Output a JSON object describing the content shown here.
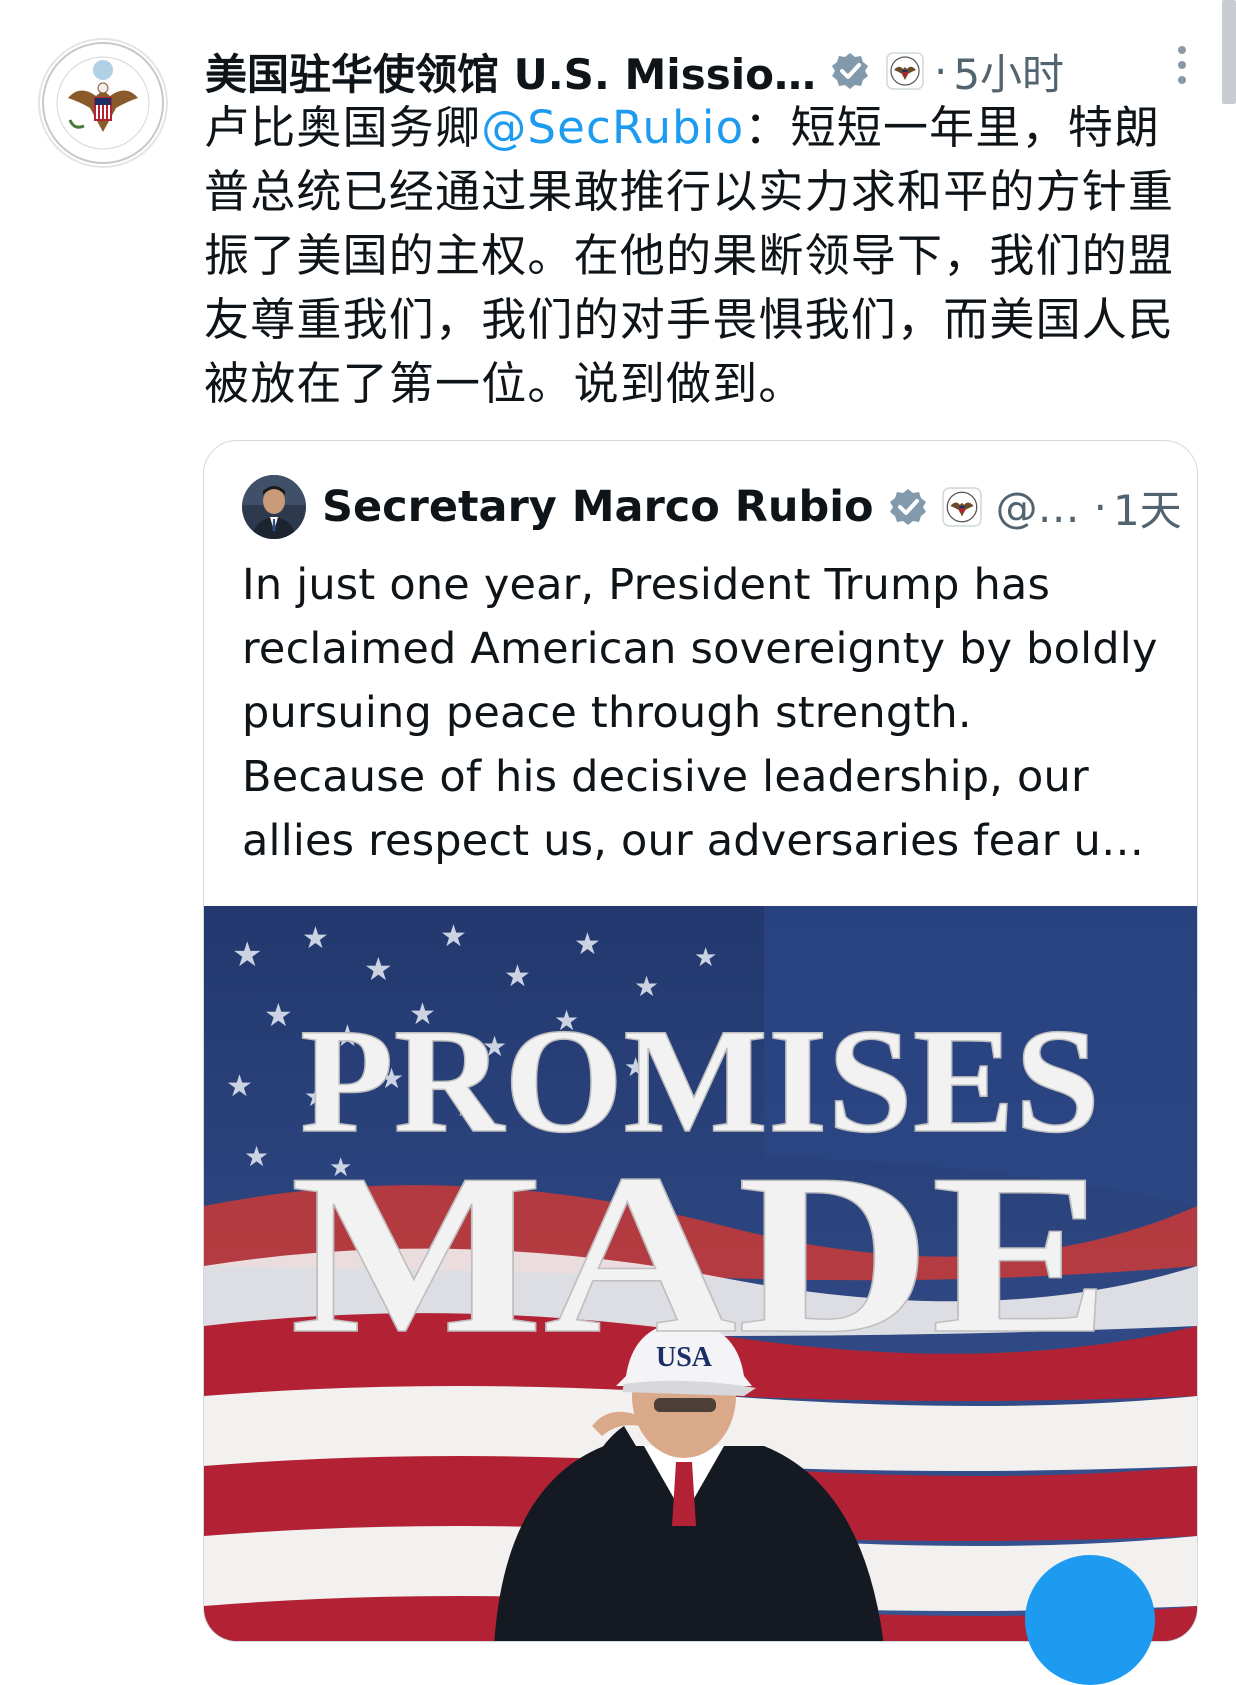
{
  "post": {
    "display_name": "美国驻华使领馆 U.S. Missio…",
    "separator": "·",
    "time": "5小时",
    "text_prefix": "卢比奥国务卿",
    "mention": "@SecRubio",
    "text_rest": "：短短一年里，特朗普总统已经通过果敢推行以实力求和平的方针重振了美国的主权。在他的果断领导下，我们的盟友尊重我们，我们的对手畏惧我们，而美国人民被放在了第一位。说到做到。"
  },
  "quote": {
    "display_name": "Secretary Marco Rubio",
    "handle": "@…",
    "separator": "·",
    "time": "1天",
    "text": "In just one year, President Trump has reclaimed American sovereignty by boldly pursuing peace through strength. Because of his decisive leadership, our allies respect us, our adversaries fear u…",
    "media": {
      "title_line1": "PROMISES",
      "title_line2": "MADE",
      "cap_text": "USA"
    }
  },
  "icons": {
    "verified": "verified-badge-icon",
    "affiliation": "state-department-seal-icon",
    "more": "more-vertical-icon"
  },
  "colors": {
    "link": "#1d9bf0",
    "verified": "#829aab",
    "muted": "#536471",
    "flag_blue": "#1b2f66",
    "flag_red": "#b22234"
  }
}
